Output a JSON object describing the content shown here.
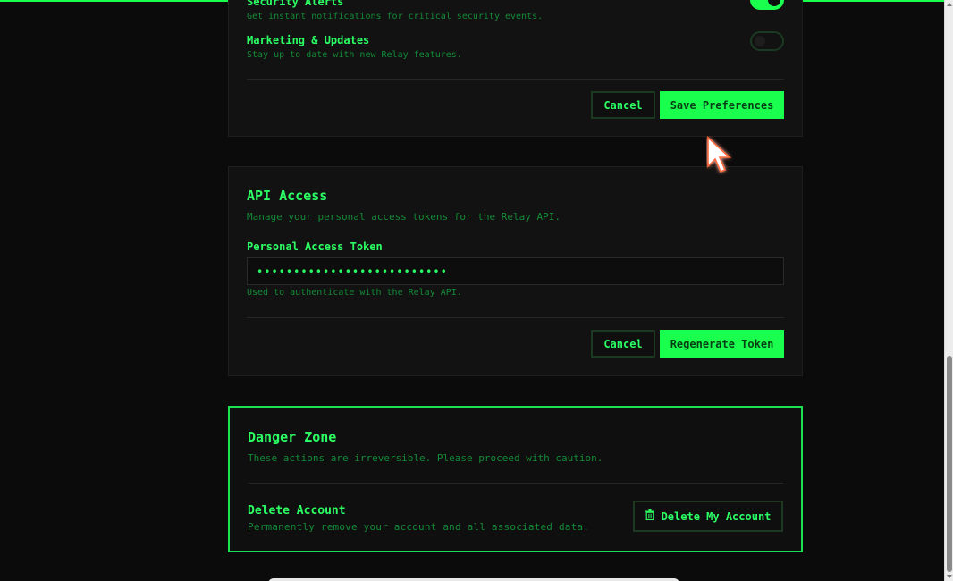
{
  "notifications": {
    "items": [
      {
        "title": "Security Alerts",
        "description": "Get instant notifications for critical security events.",
        "enabled": true
      },
      {
        "title": "Marketing & Updates",
        "description": "Stay up to date with new Relay features.",
        "enabled": false
      }
    ],
    "cancel_label": "Cancel",
    "save_label": "Save Preferences"
  },
  "api": {
    "title": "API Access",
    "subtitle": "Manage your personal access tokens for the Relay API.",
    "token_label": "Personal Access Token",
    "token_value": "••••••••••••••••••••••••••",
    "help_text": "Used to authenticate with the Relay API.",
    "cancel_label": "Cancel",
    "regenerate_label": "Regenerate Token"
  },
  "danger": {
    "title": "Danger Zone",
    "subtitle": "These actions are irreversible. Please proceed with caution.",
    "delete_title": "Delete Account",
    "delete_description": "Permanently remove your account and all associated data.",
    "delete_button_label": "Delete My Account"
  },
  "icons": {
    "trash": "trash-icon",
    "cursor": "mouse-pointer-icon"
  },
  "colors": {
    "accent": "#1aff4e",
    "background": "#0b0b0b",
    "card": "#121212"
  }
}
